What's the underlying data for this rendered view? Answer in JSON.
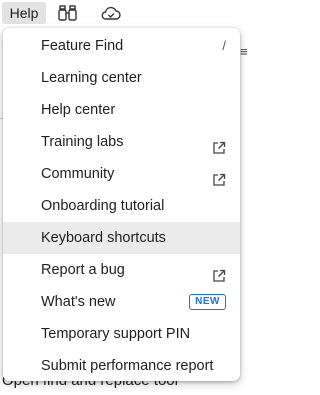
{
  "toolbar": {
    "help_label": "Help",
    "icons": [
      "binoculars-icon",
      "cloud-check-icon"
    ]
  },
  "background": {
    "partial_text": "Open find and replace tool"
  },
  "menu": {
    "items": [
      {
        "label": "Feature Find",
        "shortcut": "/"
      },
      {
        "label": "Learning center"
      },
      {
        "label": "Help center"
      },
      {
        "label": "Training labs",
        "icon": "external-link-icon"
      },
      {
        "label": "Community",
        "icon": "external-link-icon"
      },
      {
        "label": "Onboarding tutorial"
      },
      {
        "label": "Keyboard shortcuts",
        "highlighted": true
      },
      {
        "label": "Report a bug",
        "icon": "external-link-icon"
      },
      {
        "label": "What's new",
        "badge": "NEW"
      },
      {
        "label": "Temporary support PIN"
      },
      {
        "label": "Submit performance report"
      }
    ]
  },
  "colors": {
    "accent": "#1a73e8",
    "highlight": "#ebebeb",
    "help_button_bg": "#e3e3e3"
  }
}
